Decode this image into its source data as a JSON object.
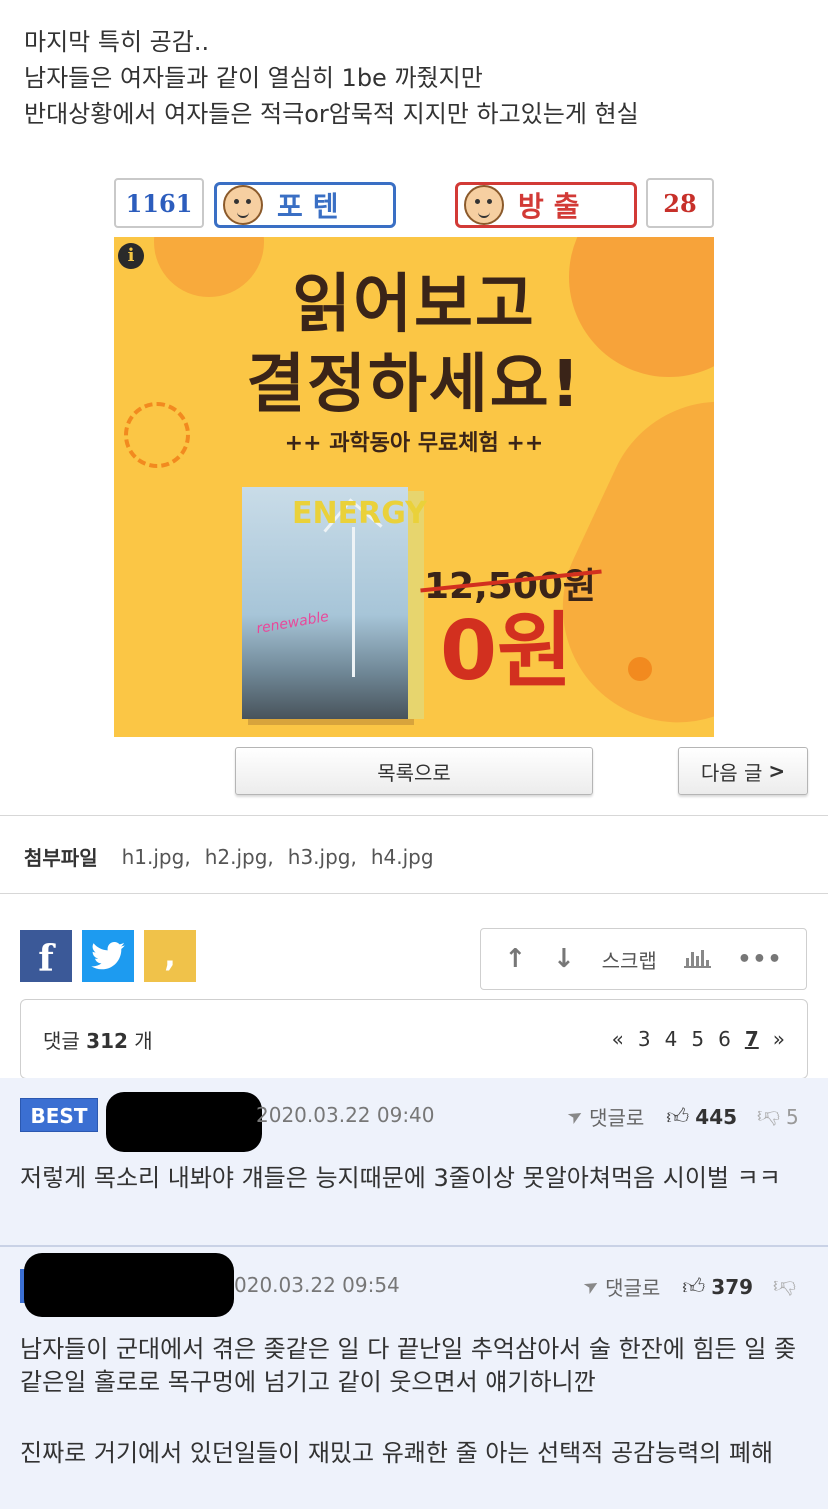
{
  "post": {
    "lines": [
      "마지막 특히 공감..",
      "남자들은 여자들과 같이 열심히 1be 까줬지만",
      "반대상황에서 여자들은 적극or암묵적 지지만 하고있는게 현실"
    ]
  },
  "vote": {
    "up_count": "1161",
    "up_label": "포텐",
    "down_label": "방출",
    "down_count": "28"
  },
  "ad": {
    "info": "i",
    "headline1": "읽어보고",
    "headline2": "결정하세요!",
    "sub": "++ 과학동아 무료체험 ++",
    "magazine_title": "ENERGY",
    "magazine_sub": "renewable",
    "old_price": "12,500원",
    "new_price": "0원"
  },
  "nav": {
    "list_label": "목록으로",
    "next_label": "다음 글",
    "next_arrow": ">"
  },
  "attachments": {
    "label": "첨부파일",
    "files": [
      "h1.jpg",
      "h2.jpg",
      "h3.jpg",
      "h4.jpg"
    ],
    "separator": ","
  },
  "share": {
    "facebook": "f",
    "kakaostory": ","
  },
  "tools": {
    "up": "↑",
    "down": "↓",
    "scrap": "스크랩",
    "more": "•••"
  },
  "comments_bar": {
    "prefix": "댓글",
    "count": "312",
    "suffix": "개",
    "pages": [
      "3",
      "4",
      "5",
      "6",
      "7"
    ],
    "current_page": "7",
    "first": "«",
    "last": "»"
  },
  "comments": [
    {
      "badge": "BEST",
      "date": "2020.03.22 09:40",
      "reply_label": "댓글로",
      "up": "445",
      "down": "5",
      "body": "저렇게 목소리 내봐야 걔들은 능지때문에 3줄이상 못알아쳐먹음 시이벌 ㅋㅋ"
    },
    {
      "date": "020.03.22 09:54",
      "reply_label": "댓글로",
      "up": "379",
      "body_lines": [
        "남자들이 군대에서 겪은 좆같은 일 다 끝난일 추억삼아서 술 한잔에 힘든 일 좆같은일 홀로로 목구멍에 넘기고 같이 웃으면서 얘기하니깐",
        "진짜로 거기에서 있던일들이 재밌고 유쾌한 줄 아는 선택적 공감능력의 폐해"
      ]
    }
  ]
}
